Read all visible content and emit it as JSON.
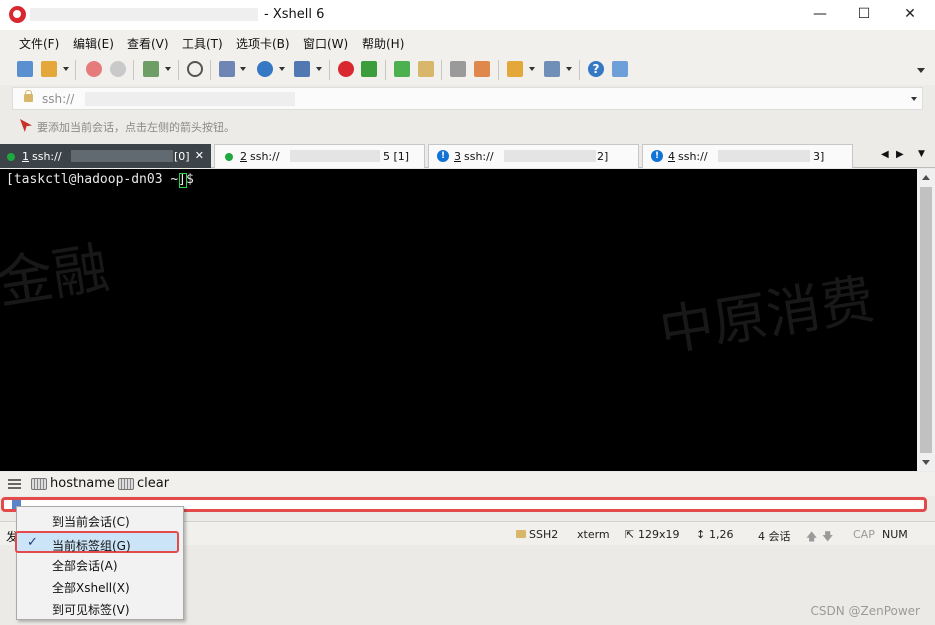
{
  "window": {
    "title": "- Xshell 6"
  },
  "menubar": [
    "文件(F)",
    "编辑(E)",
    "查看(V)",
    "工具(T)",
    "选项卡(B)",
    "窗口(W)",
    "帮助(H)"
  ],
  "address": {
    "prefix": "ssh://"
  },
  "hint": {
    "text": "要添加当前会话，点击左侧的箭头按钮。"
  },
  "tabs": [
    {
      "number": "1",
      "prefix": "ssh://",
      "suffix": "[0]",
      "status": "connected",
      "active": true
    },
    {
      "number": "2",
      "prefix": "ssh://",
      "suffix": "5 [1]",
      "status": "connected",
      "active": false
    },
    {
      "number": "3",
      "prefix": "ssh://",
      "suffix": "2]",
      "status": "warning",
      "active": false
    },
    {
      "number": "4",
      "prefix": "ssh://",
      "suffix": "3]",
      "status": "warning",
      "active": false
    }
  ],
  "terminal": {
    "prompt": "[taskctl@hadoop-dn03 ~]$ ",
    "watermark_left": "金融",
    "watermark_right": "中原消费"
  },
  "quick_commands": [
    {
      "label": "hostname"
    },
    {
      "label": "clear"
    }
  ],
  "status": {
    "left": "发",
    "protocol": "SSH2",
    "term": "xterm",
    "size": "129x19",
    "position": "1,26",
    "sessions": "4 会话",
    "cap": "CAP",
    "num": "NUM"
  },
  "context_menu": {
    "items": [
      {
        "label": "到当前会话(C)",
        "checked": false
      },
      {
        "label": "当前标签组(G)",
        "checked": true
      },
      {
        "label": "全部会话(A)",
        "checked": false
      },
      {
        "label": "全部Xshell(X)",
        "checked": false
      },
      {
        "label": "到可见标签(V)",
        "checked": false
      }
    ]
  },
  "footer": {
    "watermark": "CSDN @ZenPower"
  },
  "colors": {
    "accent_red": "#e34b4b",
    "terminal_bg": "#000000",
    "active_tab": "#3c4449",
    "connected": "#1fa83e",
    "warning": "#1372d6"
  }
}
